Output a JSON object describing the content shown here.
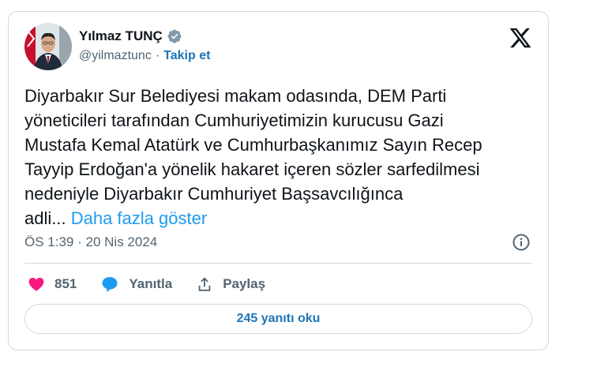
{
  "author": {
    "display_name": "Yılmaz TUNÇ",
    "handle": "@yilmaztunc",
    "separator": "·",
    "follow_label": "Takip et",
    "verified": true
  },
  "tweet": {
    "text_lines": [
      "Diyarbakır Sur Belediyesi makam odasında, DEM Parti",
      "yöneticileri tarafından Cumhuriyetimizin kurucusu Gazi",
      "Mustafa Kemal Atatürk ve Cumhurbaşkanımız Sayın Recep",
      "Tayyip Erdoğan'a yönelik hakaret içeren sözler sarfedilmesi",
      "nedeniyle Diyarbakır Cumhuriyet Başsavcılığınca",
      "adli..."
    ],
    "show_more_label": "Daha fazla göster",
    "time": "ÖS 1:39",
    "separator": "·",
    "date": "20 Nis 2024"
  },
  "actions": {
    "like_count": "851",
    "reply_label": "Yanıtla",
    "share_label": "Paylaş"
  },
  "replies_button_label": "245 yanıtı oku",
  "icons": {
    "logo": "x-logo-icon",
    "verified": "verified-badge-icon",
    "info": "info-icon",
    "like": "heart-icon",
    "reply": "speech-bubble-icon",
    "share": "share-upload-icon"
  },
  "colors": {
    "like": "#f91880",
    "reply": "#1d9bf0",
    "link": "#1d74b6",
    "show_more": "#1d9bf0",
    "text": "#0f1419",
    "muted": "#536471",
    "border": "#cfd9de"
  }
}
